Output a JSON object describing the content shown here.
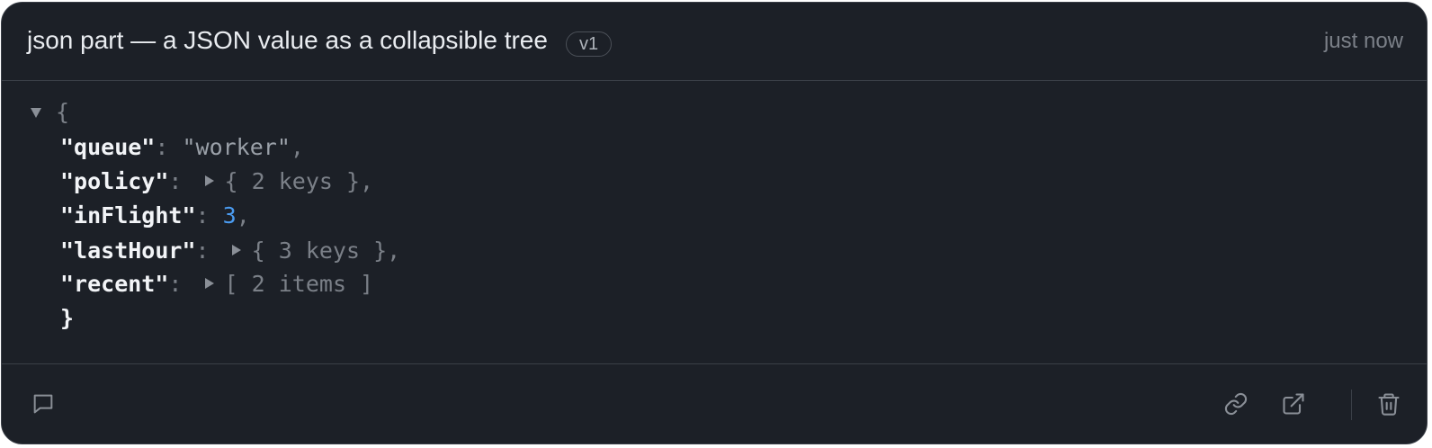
{
  "header": {
    "title": "json part — a JSON value as a collapsible tree",
    "version_badge": "v1",
    "timestamp": "just now"
  },
  "tree": {
    "open_brace": "{",
    "close_brace": "}",
    "entries": [
      {
        "key": "\"queue\"",
        "colon": ": ",
        "value": "\"worker\"",
        "value_type": "string",
        "trailing": ","
      },
      {
        "key": "\"policy\"",
        "colon": ": ",
        "value": "{ 2 keys }",
        "value_type": "collapsed-object",
        "trailing": ","
      },
      {
        "key": "\"inFlight\"",
        "colon": ": ",
        "value": "3",
        "value_type": "number",
        "trailing": ","
      },
      {
        "key": "\"lastHour\"",
        "colon": ": ",
        "value": "{ 3 keys }",
        "value_type": "collapsed-object",
        "trailing": ","
      },
      {
        "key": "\"recent\"",
        "colon": ": ",
        "value": "[ 2 items ]",
        "value_type": "collapsed-array",
        "trailing": ""
      }
    ]
  },
  "footer": {
    "left_icons": [
      "comment-icon"
    ],
    "right_icons": [
      "link-icon",
      "external-link-icon",
      "trash-icon"
    ]
  },
  "colors": {
    "background": "#1c2027",
    "border": "#3a3f47",
    "key": "#f2f4f7",
    "number": "#4a9bf0",
    "muted": "#7b8088"
  }
}
